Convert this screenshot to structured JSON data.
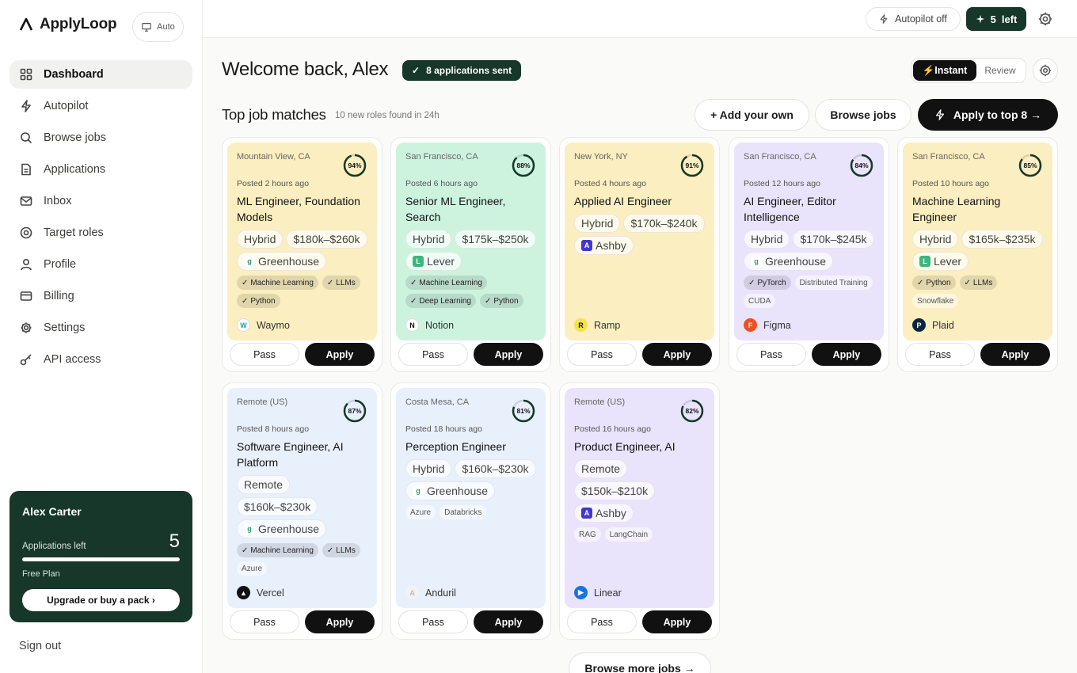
{
  "app": {
    "brand": "ApplyLoop",
    "auto_label": "Auto"
  },
  "sidebar": {
    "items": [
      {
        "label": "Dashboard",
        "icon": "grid-icon",
        "active": true
      },
      {
        "label": "Autopilot",
        "icon": "bolt-icon"
      },
      {
        "label": "Browse jobs",
        "icon": "search-icon"
      },
      {
        "label": "Applications",
        "icon": "document-icon"
      },
      {
        "label": "Inbox",
        "icon": "mail-icon"
      },
      {
        "label": "Target roles",
        "icon": "target-icon"
      },
      {
        "label": "Profile",
        "icon": "user-icon"
      },
      {
        "label": "Billing",
        "icon": "card-icon"
      },
      {
        "label": "Settings",
        "icon": "gear-icon"
      },
      {
        "label": "API access",
        "icon": "key-icon"
      }
    ],
    "plan": {
      "name": "Alex Carter",
      "apps_left_label": "Applications left",
      "apps_left": "5",
      "progress": 1.0,
      "tier": "Free Plan",
      "upgrade_label": "Upgrade or buy a pack ›"
    },
    "signout": "Sign out"
  },
  "topbar": {
    "autopilot": "Autopilot off",
    "left_count": "5",
    "left_word": "left"
  },
  "header": {
    "welcome": "Welcome back, Alex",
    "sent_badge": "8 applications sent",
    "mode_on": "⚡Instant",
    "mode_off": "Review"
  },
  "section": {
    "title": "Top job matches",
    "subtitle": "10 new roles found in 24h",
    "add_own": "+ Add your own",
    "browse": "Browse jobs",
    "apply_top": "Apply to top 8 →"
  },
  "colors": {
    "yellow": "#fbeec0",
    "green": "#cdf3df",
    "purple": "#e9e4fb",
    "blue": "#e8f0fc",
    "dark": "#17372a"
  },
  "labels": {
    "pass": "Pass",
    "apply": "Apply"
  },
  "jobs": [
    {
      "location": "Mountain View, CA",
      "match": "94%",
      "pct": 94,
      "posted": "Posted 2 hours ago",
      "title": "ML Engineer, Foundation Models",
      "chips": [
        "Hybrid",
        "$180k–$260k"
      ],
      "ats": "Greenhouse",
      "skills": [
        {
          "t": "Machine Learning",
          "m": true
        },
        {
          "t": "LLMs",
          "m": true
        },
        {
          "t": "Python",
          "m": true
        }
      ],
      "company": "Waymo",
      "bg": "yellow"
    },
    {
      "location": "San Francisco, CA",
      "match": "88%",
      "pct": 88,
      "posted": "Posted 6 hours ago",
      "title": "Senior ML Engineer, Search",
      "chips": [
        "Hybrid",
        "$175k–$250k"
      ],
      "ats": "Lever",
      "skills": [
        {
          "t": "Machine Learning",
          "m": true
        },
        {
          "t": "Deep Learning",
          "m": true
        },
        {
          "t": "Python",
          "m": true
        }
      ],
      "company": "Notion",
      "bg": "green"
    },
    {
      "location": "New York, NY",
      "match": "91%",
      "pct": 91,
      "posted": "Posted 4 hours ago",
      "title": "Applied AI Engineer",
      "chips": [
        "Hybrid",
        "$170k–$240k"
      ],
      "ats": "Ashby",
      "skills": [],
      "company": "Ramp",
      "bg": "yellow"
    },
    {
      "location": "San Francisco, CA",
      "match": "84%",
      "pct": 84,
      "posted": "Posted 12 hours ago",
      "title": "AI Engineer, Editor Intelligence",
      "chips": [
        "Hybrid",
        "$170k–$245k"
      ],
      "ats": "Greenhouse",
      "skills": [
        {
          "t": "PyTorch",
          "m": true
        },
        {
          "t": "Distributed Training",
          "m": false
        },
        {
          "t": "CUDA",
          "m": false
        }
      ],
      "company": "Figma",
      "bg": "purple"
    },
    {
      "location": "San Francisco, CA",
      "match": "85%",
      "pct": 85,
      "posted": "Posted 10 hours ago",
      "title": "Machine Learning Engineer",
      "chips": [
        "Hybrid",
        "$165k–$235k"
      ],
      "ats": "Lever",
      "skills": [
        {
          "t": "Python",
          "m": true
        },
        {
          "t": "LLMs",
          "m": true
        },
        {
          "t": "Snowflake",
          "m": false
        }
      ],
      "company": "Plaid",
      "bg": "yellow"
    },
    {
      "location": "Remote (US)",
      "match": "87%",
      "pct": 87,
      "posted": "Posted 8 hours ago",
      "title": "Software Engineer, AI Platform",
      "chips": [
        "Remote",
        "$160k–$230k"
      ],
      "ats": "Greenhouse",
      "skills": [
        {
          "t": "Machine Learning",
          "m": true
        },
        {
          "t": "LLMs",
          "m": true
        },
        {
          "t": "Azure",
          "m": false
        }
      ],
      "company": "Vercel",
      "bg": "blue"
    },
    {
      "location": "Costa Mesa, CA",
      "match": "81%",
      "pct": 81,
      "posted": "Posted 18 hours ago",
      "title": "Perception Engineer",
      "chips": [
        "Hybrid",
        "$160k–$230k"
      ],
      "ats": "Greenhouse",
      "skills": [
        {
          "t": "Azure",
          "m": false
        },
        {
          "t": "Databricks",
          "m": false
        }
      ],
      "company": "Anduril",
      "bg": "blue"
    },
    {
      "location": "Remote (US)",
      "match": "82%",
      "pct": 82,
      "posted": "Posted 16 hours ago",
      "title": "Product Engineer, AI",
      "chips": [
        "Remote",
        "$150k–$210k"
      ],
      "ats": "Ashby",
      "skills": [
        {
          "t": "RAG",
          "m": false
        },
        {
          "t": "LangChain",
          "m": false
        }
      ],
      "company": "Linear",
      "bg": "purple"
    }
  ],
  "browse_more": "Browse more jobs →"
}
